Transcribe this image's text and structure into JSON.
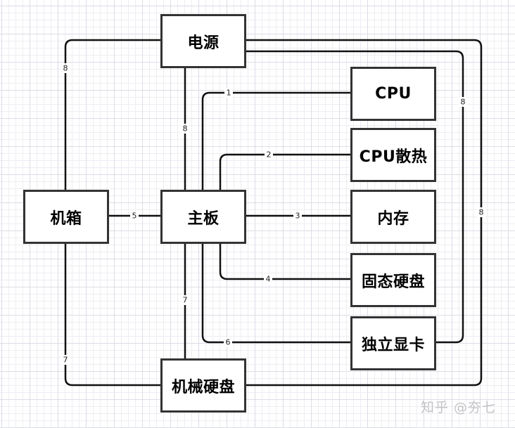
{
  "nodes": {
    "power": {
      "label": "电源"
    },
    "chassis": {
      "label": "机箱"
    },
    "motherboard": {
      "label": "主板"
    },
    "hdd": {
      "label": "机械硬盘"
    },
    "cpu": {
      "label": "CPU"
    },
    "cpu_cooler": {
      "label": "CPU散热"
    },
    "memory": {
      "label": "内存"
    },
    "ssd": {
      "label": "固态硬盘"
    },
    "gpu": {
      "label": "独立显卡"
    }
  },
  "edges": [
    {
      "id": "mb-cpu",
      "from": "主板",
      "to": "CPU",
      "label": "1"
    },
    {
      "id": "mb-cooler",
      "from": "主板",
      "to": "CPU散热",
      "label": "2"
    },
    {
      "id": "mb-memory",
      "from": "主板",
      "to": "内存",
      "label": "3"
    },
    {
      "id": "mb-ssd",
      "from": "主板",
      "to": "固态硬盘",
      "label": "4"
    },
    {
      "id": "chassis-mb",
      "from": "机箱",
      "to": "主板",
      "label": "5"
    },
    {
      "id": "mb-gpu",
      "from": "主板",
      "to": "独立显卡",
      "label": "6"
    },
    {
      "id": "mb-hdd",
      "from": "主板",
      "to": "机械硬盘",
      "label": "7"
    },
    {
      "id": "chassis-hdd",
      "from": "机箱",
      "to": "机械硬盘",
      "label": "7"
    },
    {
      "id": "power-chassis",
      "from": "电源",
      "to": "机箱",
      "label": "8"
    },
    {
      "id": "power-mb",
      "from": "电源",
      "to": "主板",
      "label": "8"
    },
    {
      "id": "power-gpu",
      "from": "电源",
      "to": "独立显卡",
      "label": "8"
    },
    {
      "id": "power-hdd",
      "from": "电源",
      "to": "机械硬盘",
      "label": "8"
    }
  ],
  "watermark": "知乎 @夯七"
}
